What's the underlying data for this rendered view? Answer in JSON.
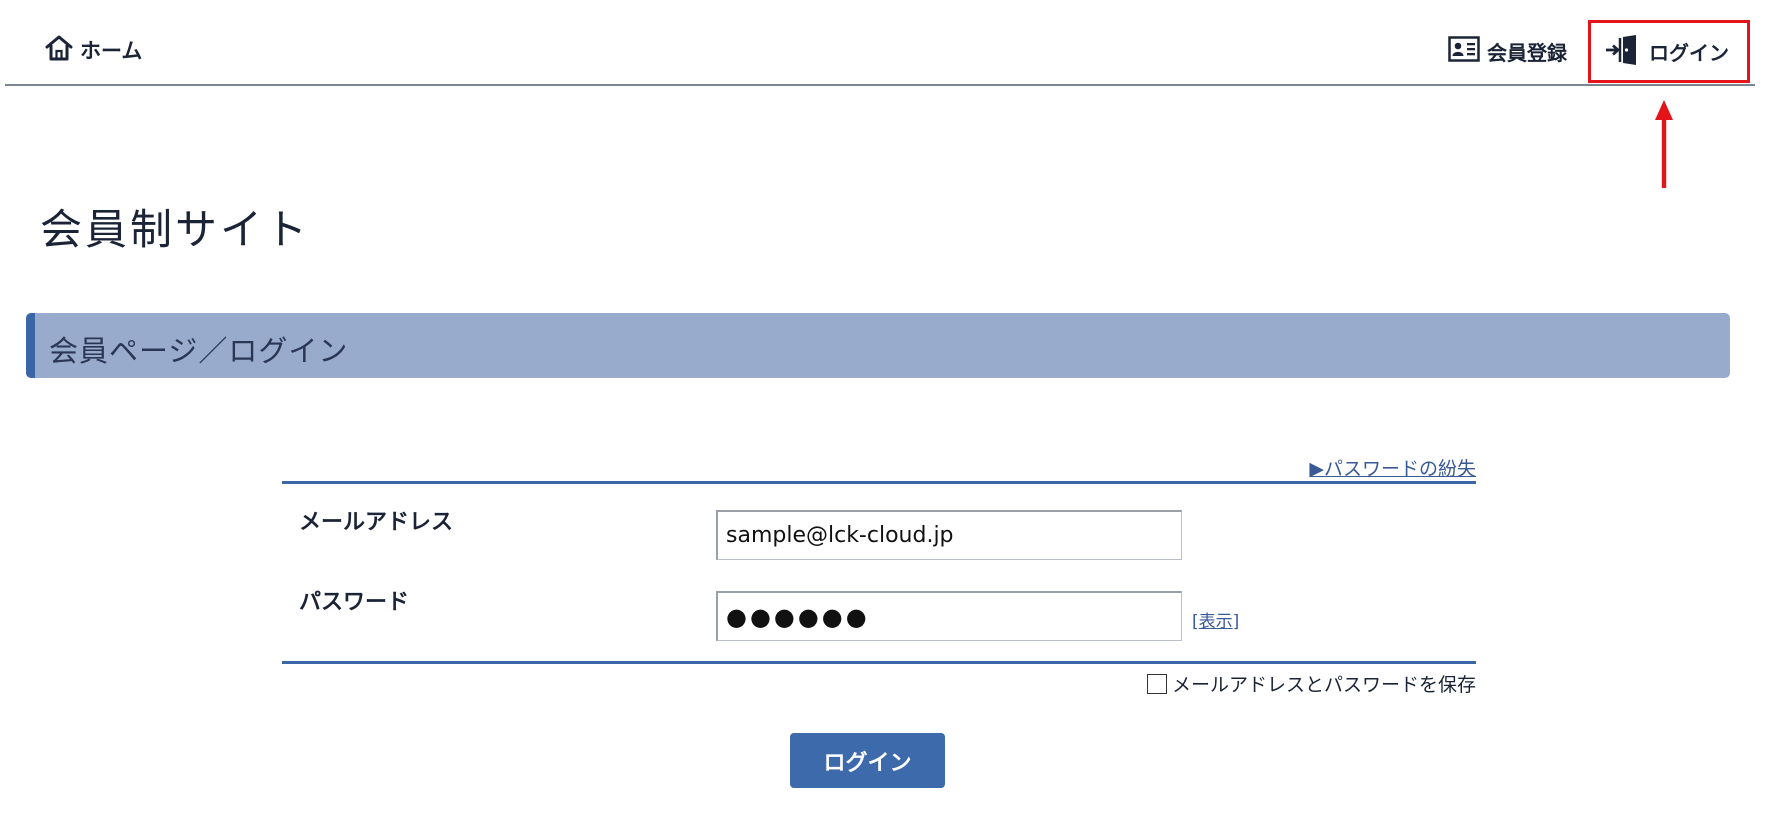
{
  "nav": {
    "home_label": "ホーム",
    "register_label": "会員登録",
    "login_label": "ログイン"
  },
  "page": {
    "site_title": "会員制サイト",
    "section_title": "会員ページ／ログイン"
  },
  "form": {
    "forgot_password_link": "▶パスワードの紛失",
    "email_label": "メールアドレス",
    "email_value": "sample@lck-cloud.jp",
    "password_label": "パスワード",
    "password_value": "●●●●●●",
    "show_bracket_open": "[",
    "show_link": "表示",
    "show_bracket_close": "]",
    "remember_checked": false,
    "remember_label": "メールアドレスとパスワードを保存",
    "submit_label": "ログイン"
  },
  "colors": {
    "accent": "#3a66a5",
    "section_bg": "#99abcc",
    "highlight": "#e4141b",
    "text": "#1b2436",
    "button_bg": "#3d6aaa"
  },
  "icons": {
    "home": "home-icon",
    "register": "id-card-icon",
    "login": "door-enter-icon",
    "annotation": "red-arrow-icon"
  }
}
